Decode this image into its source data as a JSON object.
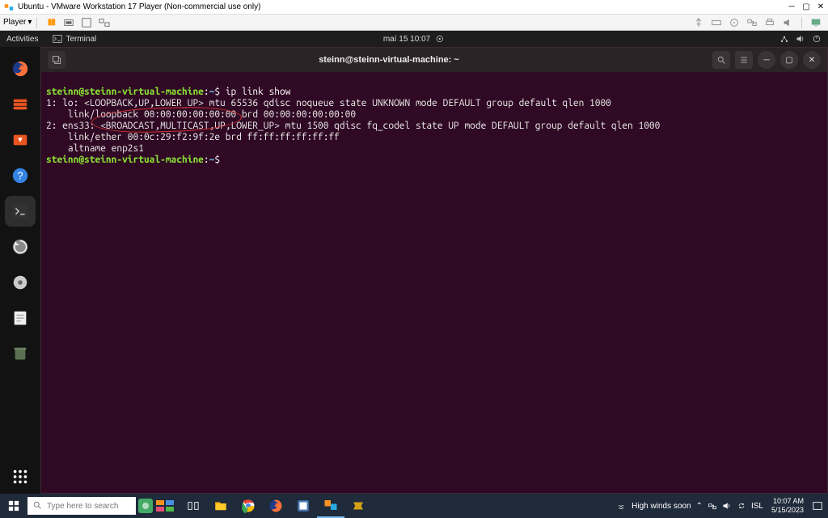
{
  "vmware": {
    "title": "Ubuntu - VMware Workstation 17 Player (Non-commercial use only)",
    "player_label": "Player"
  },
  "ubuntu_topbar": {
    "activities": "Activities",
    "terminal_menu": "Terminal",
    "datetime": "maí 15  10:07"
  },
  "terminal": {
    "title": "steinn@steinn-virtual-machine: ~",
    "prompt_user": "steinn@steinn-virtual-machine",
    "prompt_path": "~",
    "prompt_symbol": "$",
    "command": "ip link show",
    "lines": {
      "l1": "1: lo: <LOOPBACK,UP,LOWER_UP> mtu 65536 qdisc noqueue state UNKNOWN mode DEFAULT group default qlen 1000",
      "l2": "    link/loopback 00:00:00:00:00:00 brd 00:00:00:00:00:00",
      "l3": "2: ens33: <BROADCAST,MULTICAST,UP,LOWER_UP> mtu 1500 qdisc fq_codel state UP mode DEFAULT group default qlen 1000",
      "l4": "    link/ether 00:0c:29:f2:9f:2e brd ff:ff:ff:ff:ff:ff",
      "l5": "    altname enp2s1"
    }
  },
  "windows_taskbar": {
    "search_placeholder": "Type here to search",
    "weather": "High winds soon",
    "lang": "ISL",
    "time": "10:07 AM",
    "date": "5/15/2023"
  }
}
